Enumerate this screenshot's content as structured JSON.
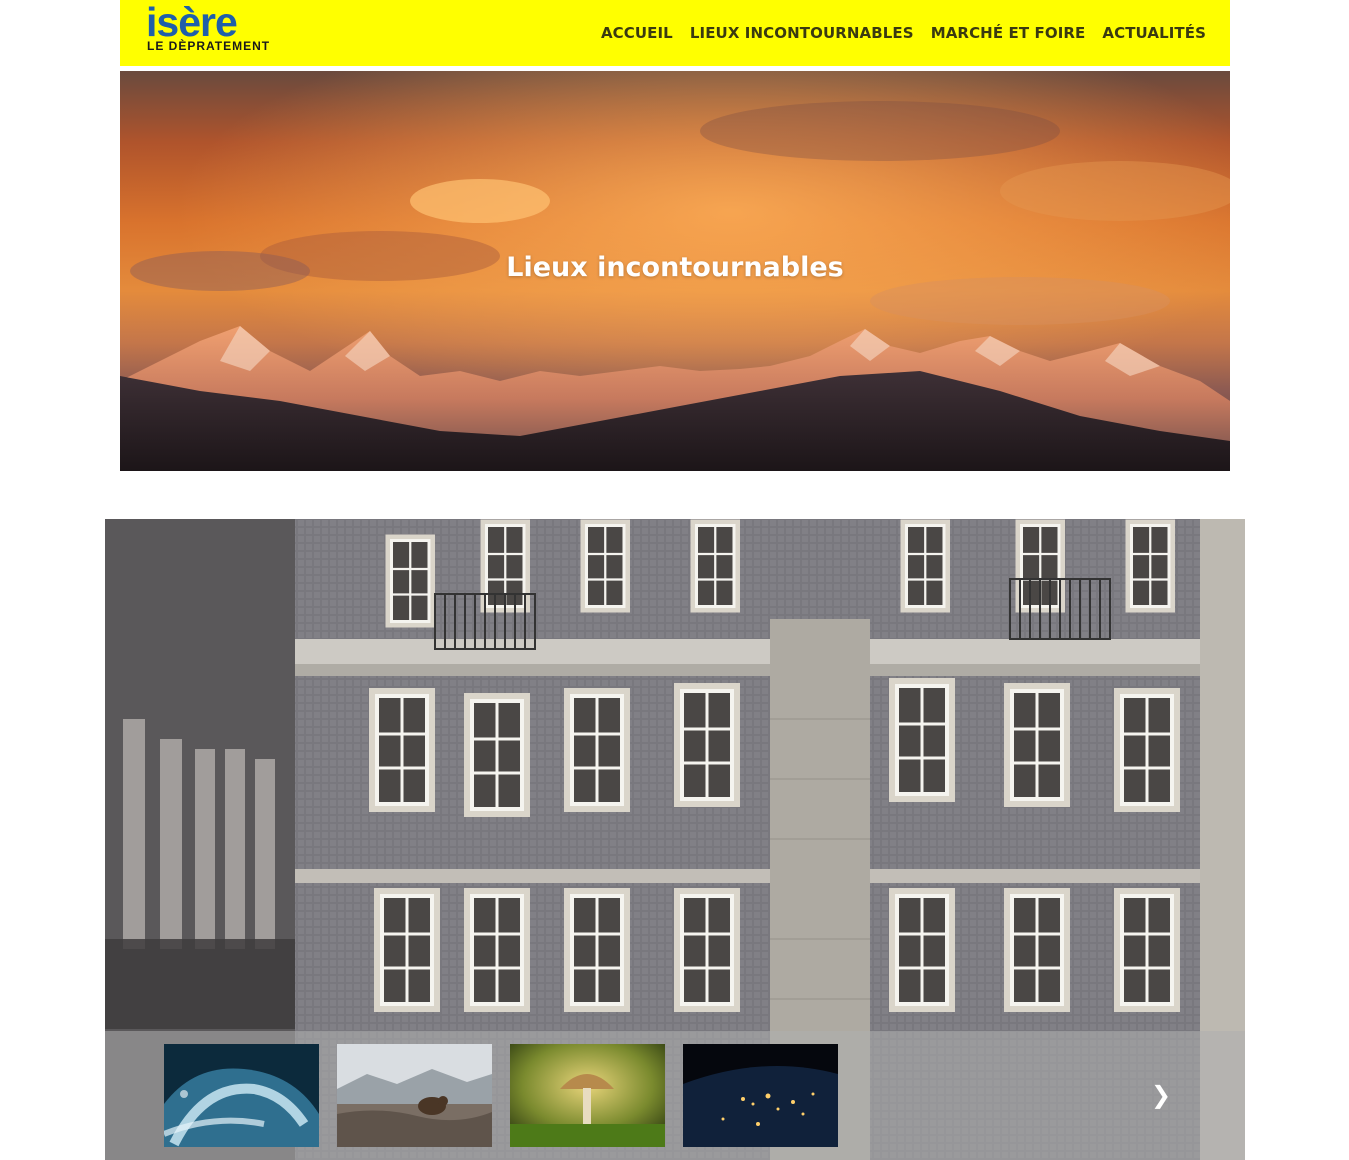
{
  "header": {
    "logo": {
      "main": "isère",
      "sub": "LE DÈPRATEMENT"
    },
    "nav": [
      {
        "label": "ACCUEIL"
      },
      {
        "label": "LIEUX INCONTOURNABLES"
      },
      {
        "label": "MARCHÉ ET FOIRE"
      },
      {
        "label": "ACTUALITÉS"
      }
    ],
    "colors": {
      "background": "#ffff00",
      "logo_blue": "#1f5faa",
      "nav_text": "#3a3a10"
    }
  },
  "hero": {
    "title": "Lieux incontournables",
    "image": "mountain-sunset-photo"
  },
  "gallery": {
    "main_image": "building-facade-photo",
    "thumbnails": [
      {
        "image": "ocean-wave-photo"
      },
      {
        "image": "beaver-in-snow-photo"
      },
      {
        "image": "mushroom-photo"
      },
      {
        "image": "earth-at-night-photo"
      }
    ],
    "next_icon": "chevron-right-icon"
  }
}
